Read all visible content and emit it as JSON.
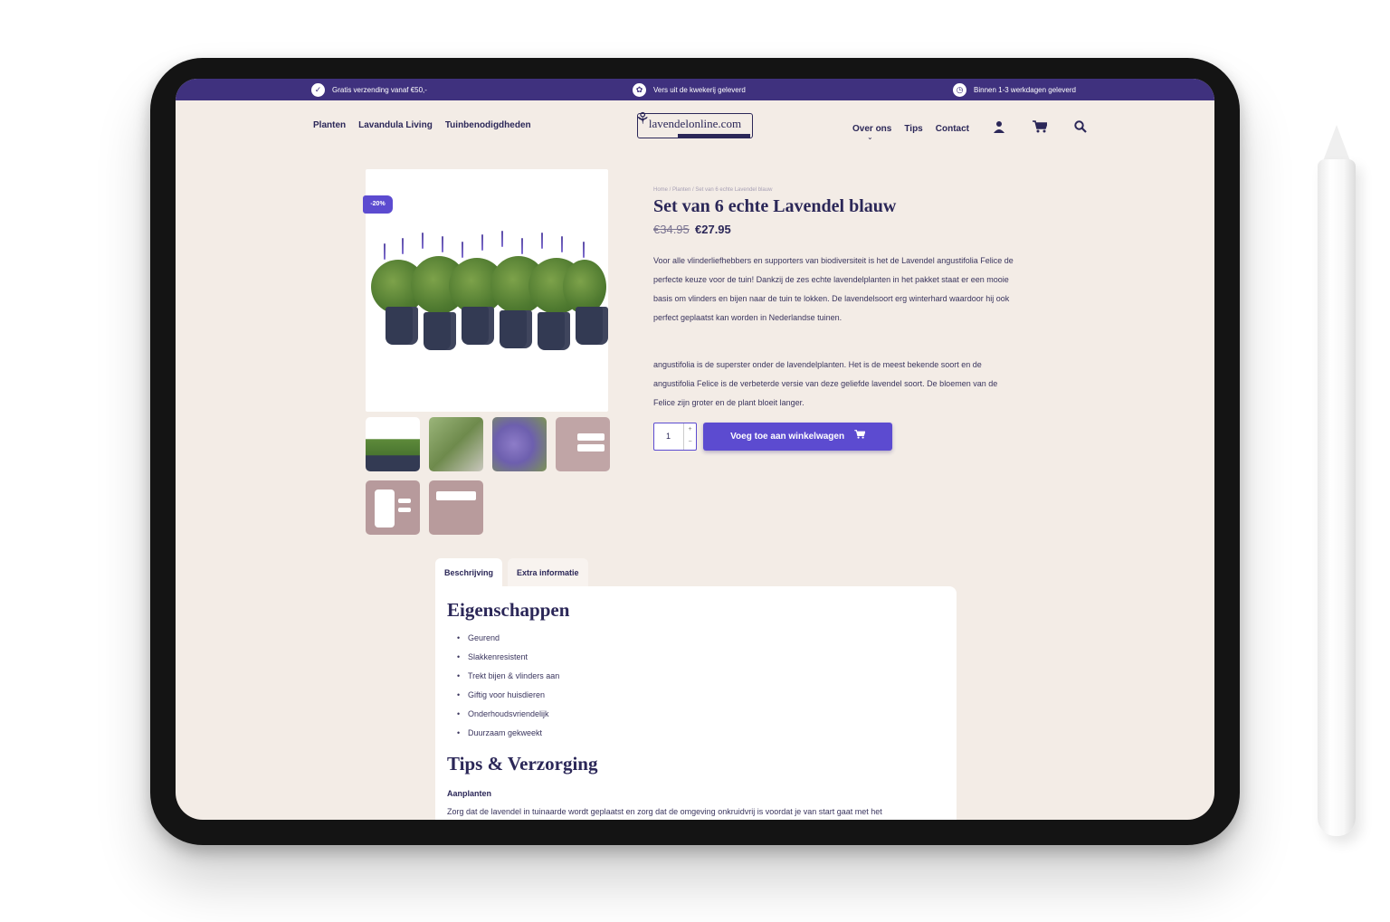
{
  "topbar": {
    "usp_1": "Gratis verzending vanaf €50,-",
    "usp_2": "Vers uit de kwekerij geleverd",
    "usp_3": "Binnen 1-3 werkdagen geleverd"
  },
  "nav": {
    "left": [
      "Planten",
      "Lavandula Living",
      "Tuinbenodigdheden"
    ],
    "right": [
      "Over ons",
      "Tips",
      "Contact"
    ],
    "logo": "lavendelonline.com"
  },
  "icons": {
    "account": "user-icon",
    "cart": "cart-icon",
    "search": "search-icon"
  },
  "product": {
    "breadcrumb": "Home / Planten / Set van 6 echte Lavendel blauw",
    "title": "Set van 6 echte Lavendel blauw",
    "price_old": "€34.95",
    "price_new": "€27.95",
    "badge": "-20%",
    "desc_1": "Voor alle vlinderliefhebbers en supporters van biodiversiteit is het de Lavendel angustifolia Felice de perfecte keuze voor de tuin! Dankzij de zes echte lavendelplanten in het pakket staat er een mooie basis om vlinders en bijen naar de tuin te lokken. De lavendelsoort erg winterhard waardoor hij ook perfect geplaatst kan worden in Nederlandse tuinen.",
    "desc_2": "angustifolia is de superster onder de lavendelplanten. Het is de meest bekende soort en de angustifolia Felice is de verbeterde versie van deze geliefde lavendel soort. De bloemen van de Felice zijn groter en de plant bloeit langer.",
    "quantity": "1",
    "add_to_cart": "Voeg toe aan winkelwagen"
  },
  "tabs": [
    "Beschrijving",
    "Extra informatie"
  ],
  "content": {
    "h_properties": "Eigenschappen",
    "properties": [
      "Geurend",
      "Slakkenresistent",
      "Trekt bijen & vlinders aan",
      "Giftig voor huisdieren",
      "Onderhoudsvriendelijk",
      "Duurzaam gekweekt"
    ],
    "h_tips": "Tips & Verzorging",
    "sub_planting": "Aanplanten",
    "planting_text": "Zorg dat de lavendel in tuinaarde wordt geplaatst en zorg dat de omgeving onkruidvrij is voordat je van start gaat met het"
  },
  "colors": {
    "primary": "#3f317e",
    "accent": "#5c4bd0",
    "background": "#f3ece6",
    "text": "#2b2758"
  }
}
